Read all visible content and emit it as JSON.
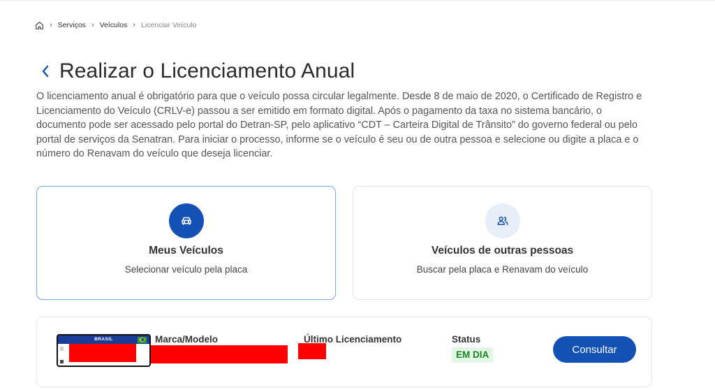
{
  "breadcrumb": {
    "home_icon": "home-icon",
    "items": [
      "Serviços",
      "Veículos",
      "Licenciar Veículo"
    ]
  },
  "header": {
    "back_icon": "chevron-left-icon",
    "title": "Realizar o Licenciamento Anual"
  },
  "intro": {
    "text": "O licenciamento anual é obrigatório para que o veículo possa circular legalmente. Desde 8 de maio de 2020, o Certificado de Registro e Licenciamento do Veículo (CRLV-e) passou a ser emitido em formato digital. Após o pagamento da taxa no sistema bancário, o documento pode ser acessado pelo portal do Detran-SP, pelo aplicativo “CDT – Carteira Digital de Trânsito” do governo federal ou pelo portal de serviços da Senatran. Para iniciar o processo, informe se o veículo é seu ou de outra pessoa e selecione ou digite a placa e o número do Renavam do veículo que deseja licenciar."
  },
  "options": [
    {
      "icon": "car-icon",
      "title": "Meus Veículos",
      "subtitle": "Selecionar veículo pela placa",
      "selected": true
    },
    {
      "icon": "users-icon",
      "title": "Veículos de outras pessoas",
      "subtitle": "Buscar pela placa e Renavam do veículo",
      "selected": false
    }
  ],
  "vehicle": {
    "plate_header": "BRASIL",
    "labels": {
      "model": "Marca/Modelo",
      "last_license": "Último Licenciamento",
      "status": "Status"
    },
    "status_value": "EM DIA",
    "action_label": "Consultar"
  },
  "colors": {
    "primary": "#1351b4",
    "selected_border": "#7fa8dc",
    "status_bg": "#e3f5e4",
    "status_text": "#168821",
    "redaction": "#ff0000"
  }
}
